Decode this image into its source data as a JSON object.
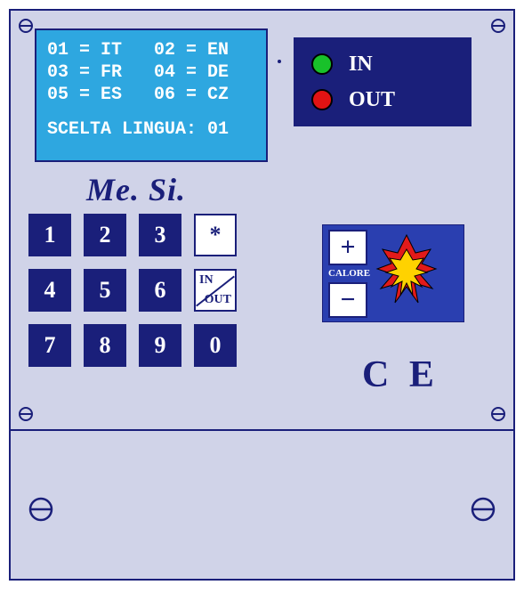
{
  "lcd": {
    "line1_left": "01 = IT",
    "line1_right": "02 = EN",
    "line2_left": "03 = FR",
    "line2_right": "04 = DE",
    "line3_left": "05 = ES",
    "line3_right": "06 = CZ",
    "prompt": "SCELTA LINGUA: 01",
    "language_options": [
      {
        "code": "01",
        "lang": "IT"
      },
      {
        "code": "02",
        "lang": "EN"
      },
      {
        "code": "03",
        "lang": "FR"
      },
      {
        "code": "04",
        "lang": "DE"
      },
      {
        "code": "05",
        "lang": "ES"
      },
      {
        "code": "06",
        "lang": "CZ"
      }
    ],
    "selected": "01"
  },
  "inout": {
    "in_label": "IN",
    "out_label": "OUT",
    "in_color": "#18c12a",
    "out_color": "#e11313"
  },
  "brand": "Me.  Si.",
  "keypad": {
    "k1": "1",
    "k2": "2",
    "k3": "3",
    "k4": "4",
    "k5": "5",
    "k6": "6",
    "k7": "7",
    "k8": "8",
    "k9": "9",
    "k0": "0",
    "star": "*",
    "inout_top": "IN",
    "inout_bot": "OUT"
  },
  "calore": {
    "plus": "+",
    "minus": "−",
    "label": "CALORE"
  },
  "ce": "C E"
}
